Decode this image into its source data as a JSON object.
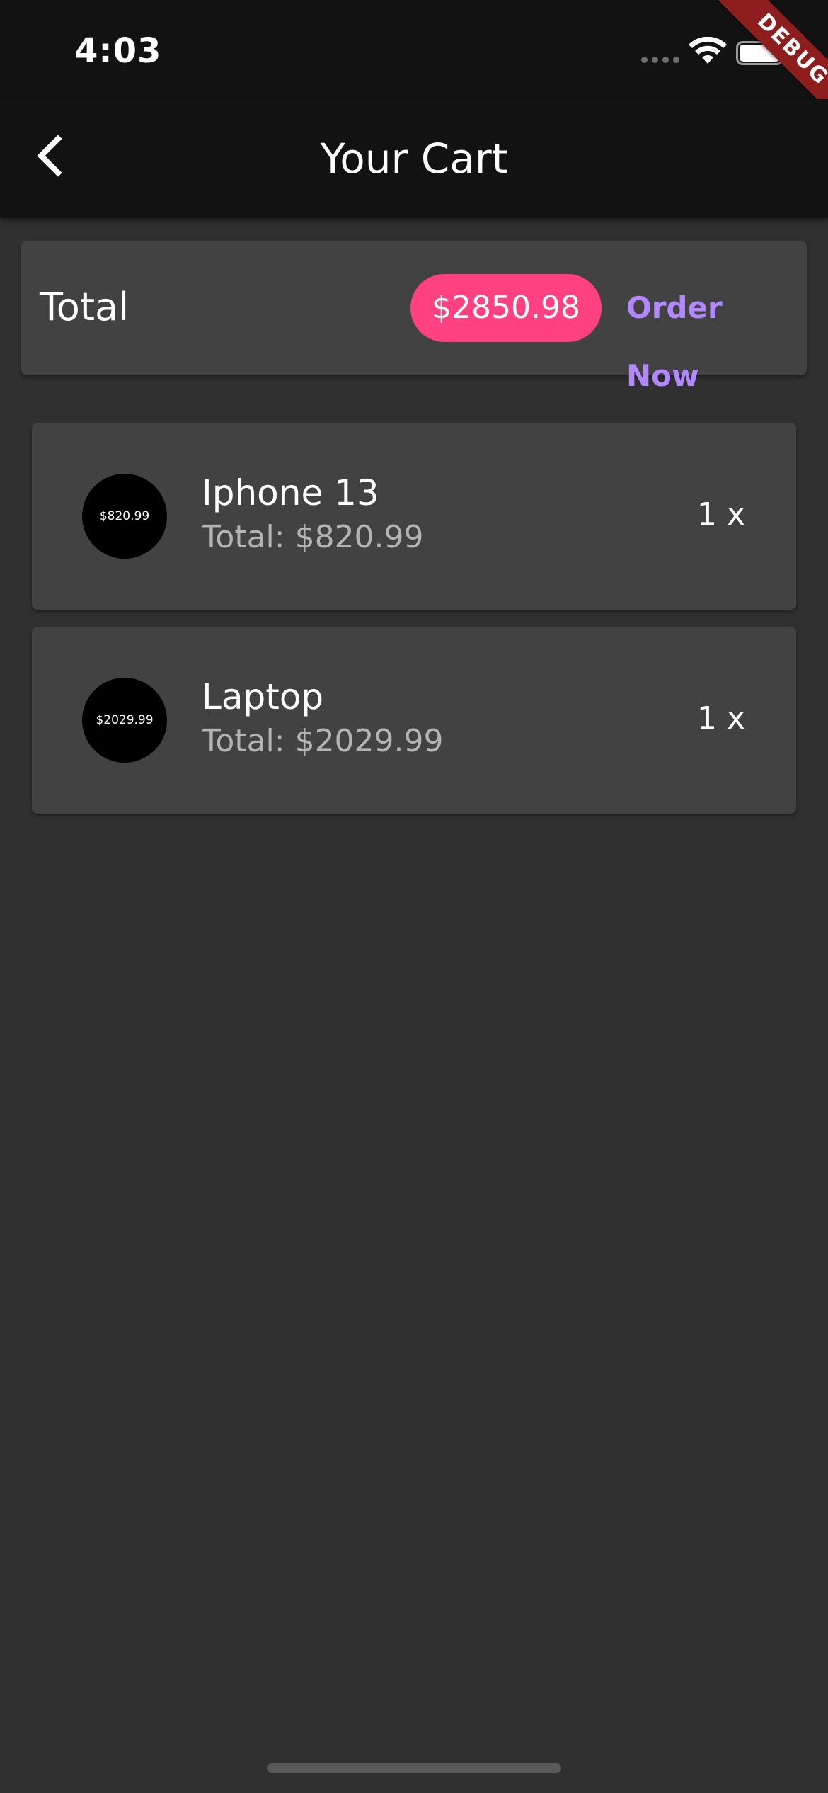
{
  "status_bar": {
    "time": "4:03",
    "icons": [
      "cellular-signal-icon",
      "wifi-icon",
      "battery-icon"
    ]
  },
  "debug_banner": "DEBUG",
  "app_bar": {
    "title": "Your Cart",
    "back_icon": "chevron-left-icon"
  },
  "total_card": {
    "label": "Total",
    "amount": "$2850.98",
    "order_button": "Order Now"
  },
  "cart_items": [
    {
      "avatar_text": "$820.99",
      "title": "Iphone 13",
      "subtitle": "Total: $820.99",
      "quantity": "1 x"
    },
    {
      "avatar_text": "$2029.99",
      "title": "Laptop",
      "subtitle": "Total: $2029.99",
      "quantity": "1 x"
    }
  ],
  "colors": {
    "background": "#303030",
    "bar": "#121212",
    "card": "#424242",
    "chip": "#ff4081",
    "order_button": "#b388ff",
    "debug_ribbon": "#8e1d1d"
  }
}
